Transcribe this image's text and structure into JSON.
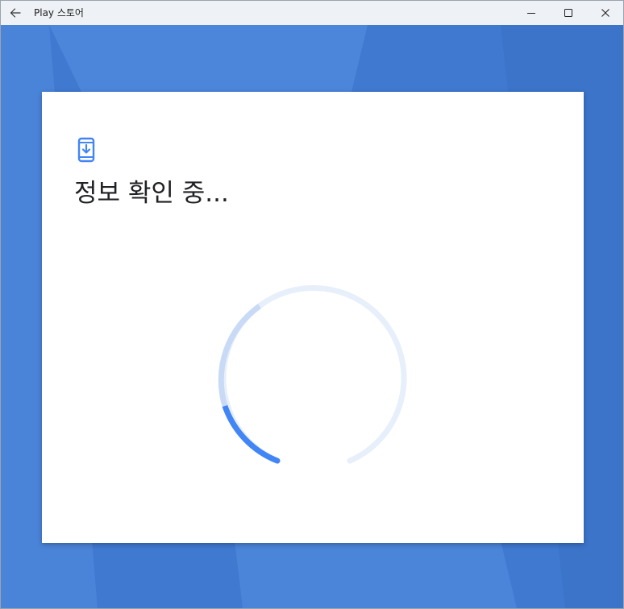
{
  "window": {
    "title": "Play 스토어",
    "back_icon": "arrow-left-icon",
    "minimize_icon": "minimize-icon",
    "maximize_icon": "maximize-icon",
    "close_icon": "close-icon"
  },
  "colors": {
    "background": "#3f7ad0",
    "background_light": "#4f86da",
    "accent": "#4285f4",
    "spinner_track": "#e8f0fc"
  },
  "dialog": {
    "icon": "phone-download-icon",
    "title": "정보 확인 중...",
    "spinner_icon": "loading-spinner-icon"
  }
}
